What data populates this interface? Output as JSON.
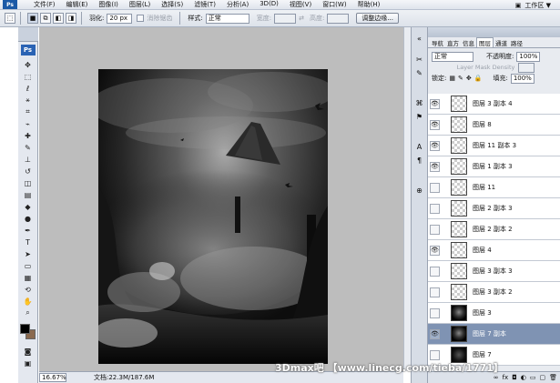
{
  "menubar": {
    "app_logo": "Ps",
    "items": [
      "文件(F)",
      "编辑(E)",
      "图像(I)",
      "图层(L)",
      "选择(S)",
      "滤镜(T)",
      "分析(A)",
      "3D(D)",
      "视图(V)",
      "窗口(W)",
      "帮助(H)"
    ],
    "workspace": "工作区 ▼"
  },
  "options": {
    "feather_label": "羽化:",
    "feather_value": "20 px",
    "antialias_label": "消除锯齿",
    "style_label": "样式:",
    "style_value": "正常",
    "width_label": "宽度:",
    "height_label": "高度:",
    "refine_button": "调整边缘..."
  },
  "status": {
    "zoom": "16.67%",
    "doc": "文档:22.3M/187.6M"
  },
  "layers_panel": {
    "tabs": [
      "导航",
      "直方",
      "信息",
      "图层",
      "通道",
      "路径"
    ],
    "active_tab": "图层",
    "blend_mode": "正常",
    "opacity_label": "不透明度:",
    "opacity_value": "100%",
    "mask_density": "Layer Mask Density",
    "lock_label": "锁定:",
    "fill_label": "填充:",
    "fill_value": "100%",
    "layers": [
      {
        "name": "图层 3 副本 4",
        "visible": true,
        "thumb": "check"
      },
      {
        "name": "图层 8",
        "visible": true,
        "thumb": "check"
      },
      {
        "name": "图层 11 副本 3",
        "visible": true,
        "thumb": "check"
      },
      {
        "name": "图层 1 副本 3",
        "visible": true,
        "thumb": "check"
      },
      {
        "name": "图层 11",
        "visible": false,
        "thumb": "check"
      },
      {
        "name": "图层 2 副本 3",
        "visible": false,
        "thumb": "check"
      },
      {
        "name": "图层 2 副本 2",
        "visible": false,
        "thumb": "check"
      },
      {
        "name": "图层 4",
        "visible": true,
        "thumb": "check"
      },
      {
        "name": "图层 3 副本 3",
        "visible": false,
        "thumb": "check"
      },
      {
        "name": "图层 3 副本 2",
        "visible": false,
        "thumb": "check"
      },
      {
        "name": "图层 3",
        "visible": false,
        "thumb": "dark"
      },
      {
        "name": "图层 7 副本",
        "visible": true,
        "thumb": "dark",
        "selected": true
      },
      {
        "name": "图层 7",
        "visible": false,
        "thumb": "darker"
      }
    ]
  },
  "watermark": "3Dmax吧 【www.linecg.com/tieba/1771】",
  "colors": {
    "foreground": "#000000",
    "background": "#8b6a4f",
    "selected_layer": "#7f93b3"
  }
}
